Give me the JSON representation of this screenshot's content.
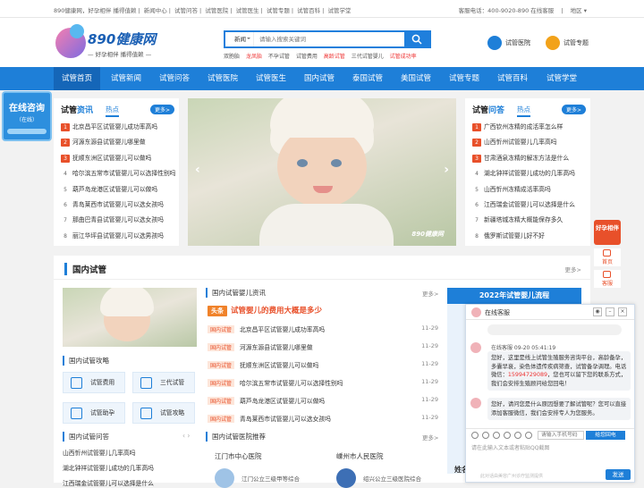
{
  "topbar": {
    "left_items": [
      "890健康网，好孕相伴 播得值赖",
      "新闻中心",
      "试管问答",
      "试管医院",
      "试管医生",
      "试管专题",
      "试管百科",
      "试管学堂"
    ],
    "right_text": "客服电话：400-9020-890 在线客服",
    "region": "地区"
  },
  "header": {
    "brand": "890健康网",
    "slogan": "— 好孕相伴  播得值赖 —",
    "search": {
      "category": "新闻",
      "placeholder": "请输入搜索关键词"
    },
    "hotkeys": [
      {
        "text": "双胞胎",
        "hot": false
      },
      {
        "text": "龙凤胎",
        "hot": true
      },
      {
        "text": "不孕试管",
        "hot": false
      },
      {
        "text": "试管费用",
        "hot": false
      },
      {
        "text": "高龄试管",
        "hot": true
      },
      {
        "text": "三代试管婴儿",
        "hot": false
      },
      {
        "text": "试管成功率",
        "hot": true
      }
    ],
    "link_hospital": "试管医院",
    "link_topic": "试管专题"
  },
  "nav": [
    "试管首页",
    "试管新闻",
    "试管问答",
    "试管医院",
    "试管医生",
    "国内试管",
    "泰国试管",
    "美国试管",
    "试管专题",
    "试管百科",
    "试管学堂"
  ],
  "consult": {
    "title": "在线咨询",
    "subtitle": "（在线）"
  },
  "left_panel": {
    "title_a": "试管",
    "title_b": "资讯",
    "tab": "热点",
    "more": "更多>",
    "items": [
      "北京昌平区试管婴儿成功率高吗",
      "河源东源县试管婴儿哪里做",
      "抚顺东洲区试管婴儿可以做吗",
      "哈尔滨五常市试管婴儿可以选择性别吗",
      "葫芦岛龙港区试管婴儿可以做吗",
      "青岛莱西市试管婴儿可以选女孩吗",
      "那曲巴青县试管婴儿可以选女孩吗",
      "丽江华坪县试管婴儿可以选男孩吗"
    ]
  },
  "right_panel": {
    "title_a": "试管",
    "title_b": "问答",
    "tab": "热点",
    "more": "更多>",
    "items": [
      "广西钦州冻精的成活率怎么样",
      "山西忻州试管婴儿几率高吗",
      "甘肃酒泉冻精的解冻方法是什么",
      "湖北钟祥试管婴儿成功的几率高吗",
      "山西忻州冻精成活率高吗",
      "江西瑞金试管婴儿可以选择是什么",
      "新疆塔城冻精大概能保存多久",
      "俄罗斯试管婴儿好不好"
    ]
  },
  "banner": {
    "watermark": "890健康网"
  },
  "section": {
    "title": "国内试管",
    "more": "更多>",
    "strategy_title": "国内试管攻略",
    "buttons": [
      "试管费用",
      "三代试管",
      "试管助孕",
      "试管攻略"
    ],
    "qa_title": "国内试管问答",
    "qa_items": [
      "山西忻州试管婴儿几率高吗",
      "湖北钟祥试管婴儿成功的几率高吗",
      "江西瑞金试管婴儿可以选择是什么"
    ],
    "news_title": "国内试管婴儿资讯",
    "news_more": "更多>",
    "headline_tag": "头条",
    "headline": "试管婴儿的费用大概是多少",
    "news_tag": "国内试管",
    "news": [
      {
        "title": "北京昌平区试管婴儿成功率高吗",
        "date": "11-29"
      },
      {
        "title": "河源东源县试管婴儿哪里做",
        "date": "11-29"
      },
      {
        "title": "抚顺东洲区试管婴儿可以做吗",
        "date": "11-29"
      },
      {
        "title": "哈尔滨五常市试管婴儿可以选择性别吗",
        "date": "11-29"
      },
      {
        "title": "葫芦岛龙港区试管婴儿可以做吗",
        "date": "11-29"
      },
      {
        "title": "青岛莱西市试管婴儿可以选女孩吗",
        "date": "11-29"
      }
    ],
    "hosp_title": "国内试管医院推荐",
    "hosp_more": "更多>",
    "hospitals": [
      {
        "name": "江门市中心医院",
        "desc": "江门公立三级甲等综合"
      },
      {
        "name": "嵊州市人民医院",
        "desc": "绍兴公立三级医院综合"
      }
    ],
    "flow_title": "2022年试管婴儿流程",
    "side_label": "姓名"
  },
  "chat": {
    "title": "在线客服",
    "who": "在线客服 09-20 05:41:19",
    "msg1_a": "您好，这里是线上试管生殖服务咨询平台，高龄备孕，多囊早衰，染色体遗传疾病筛查，试管备孕调理。电话微信：",
    "msg1_phone": "15994729089",
    "msg1_b": "，您也可以留下您的联系方式，我们会安排生殖顾问给您回电！",
    "msg2": "您好，请问您是什么原因想要了解试管呢？您可以直接添加客服微信，我们会安排专人为您服务。",
    "phone_placeholder": "请输入手机号码",
    "confirm": "给您回电",
    "input_placeholder": "请在此输入文本或者粘贴QQ截图",
    "footer": "此对话由美容广州诊疗监测提供",
    "send": "发送"
  },
  "float": {
    "gift": "好孕相伴",
    "home": "首页",
    "service": "客服"
  }
}
